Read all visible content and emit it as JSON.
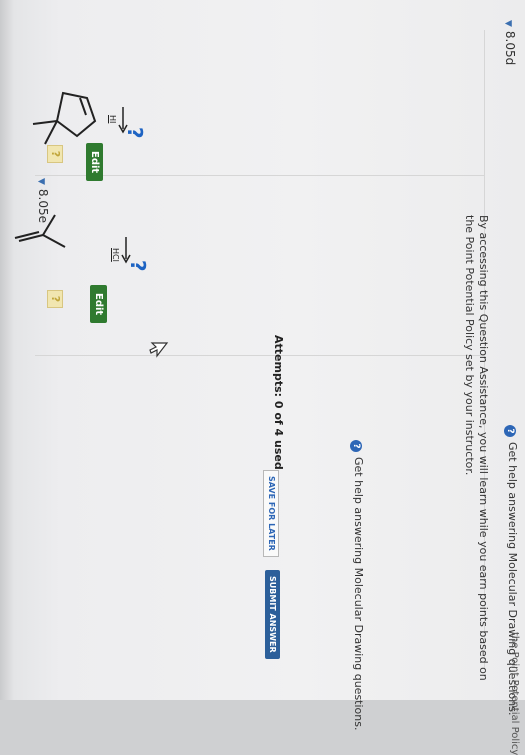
{
  "sections": [
    {
      "title": "8.05d",
      "reagent": "HI",
      "product_placeholder": "?",
      "help_text": "Get help answering Molecular Drawing questions.",
      "help_icon_char": "?",
      "answer_box_char": "?",
      "edit_label": "Edit"
    },
    {
      "title": "8.05e",
      "reagent": "HCl",
      "product_placeholder": "?",
      "help_text": "Get help answering Molecular Drawing questions.",
      "help_icon_char": "?",
      "answer_box_char": "?",
      "edit_label": "Edit"
    }
  ],
  "assistance_text": "By accessing this Question Assistance, you will learn while you earn points based on the Point Potential Policy set by your instructor.",
  "attempts_text": "Attempts: 0 of 4 used",
  "save_label": "SAVE FOR LATER",
  "submit_label": "SUBMIT ANSWER",
  "footer_link": "the Point Potential Policy",
  "colors": {
    "accent_blue": "#1d63c3",
    "edit_green": "#2f7a2f",
    "submit_blue": "#2c5f9a",
    "answer_box_yellow": "#f1e6b0"
  }
}
